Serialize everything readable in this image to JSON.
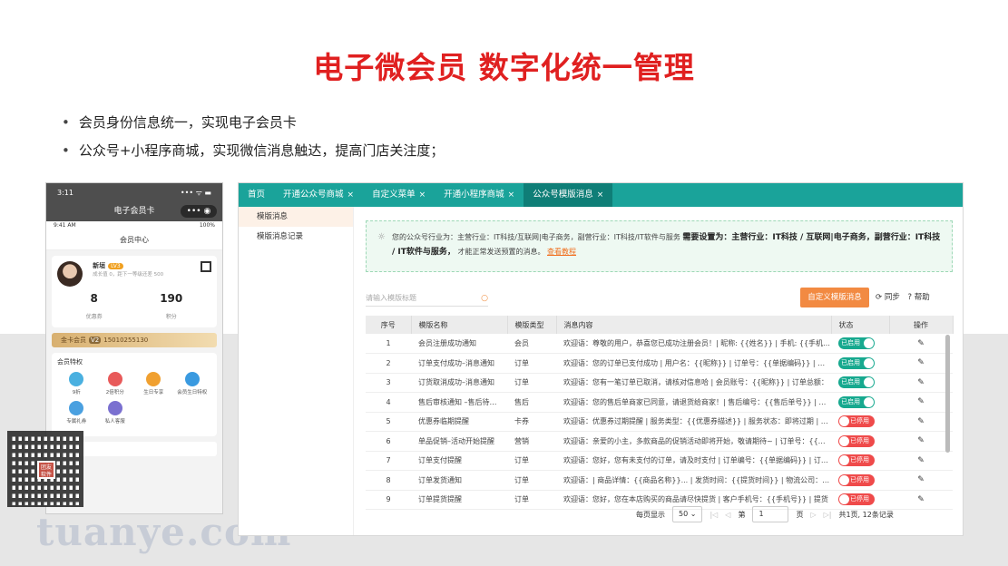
{
  "slide": {
    "title": "电子微会员  数字化统一管理",
    "bullets": [
      "会员身份信息统一，实现电子会员卡",
      "公众号+小程序商城，实现微信消息触达，提高门店关注度；"
    ],
    "watermark": "tuanye.com"
  },
  "phone": {
    "time": "3:11",
    "signal": "••• ᯤ ▬",
    "title": "电子会员卡",
    "pill": "•••  ◉",
    "inner_time": "9:41 AM",
    "battery": "100%",
    "header": "会员中心",
    "user": {
      "name": "新垣",
      "level": "LV3",
      "growth": "成长值 0，距下一等级还差 500"
    },
    "stats": [
      {
        "value": "8",
        "label": "优惠券"
      },
      {
        "value": "190",
        "label": "积分"
      }
    ],
    "gold": {
      "label": "金卡会员",
      "badge": "V2",
      "phone": "15010255130"
    },
    "privs_title": "会员特权",
    "privs": [
      {
        "label": "9折",
        "color": "#4ab0e0"
      },
      {
        "label": "2倍积分",
        "color": "#e85a5a"
      },
      {
        "label": "生日专享",
        "color": "#f0a030"
      },
      {
        "label": "会员生日特权",
        "color": "#3a9ae0"
      },
      {
        "label": "专属礼券",
        "color": "#4aa0e0"
      },
      {
        "label": "私人客服",
        "color": "#7a70d0"
      }
    ],
    "qr_logo": "团友软件"
  },
  "admin": {
    "tabs": [
      {
        "label": "首页",
        "close": false,
        "active": false
      },
      {
        "label": "开通公众号商城",
        "close": true,
        "active": false
      },
      {
        "label": "自定义菜单",
        "close": true,
        "active": false
      },
      {
        "label": "开通小程序商城",
        "close": true,
        "active": false
      },
      {
        "label": "公众号模版消息",
        "close": true,
        "active": true
      }
    ],
    "close_glyph": "×",
    "side": [
      "模版消息",
      "模版消息记录"
    ],
    "notice": {
      "normal": "您的公众号行业为：主营行业：IT科技/互联网|电子商务，副营行业：IT科技/IT软件与服务",
      "bold": "需要设置为：主营行业：IT科技 / 互联网|电子商务，副营行业：IT科技 / IT软件与服务，",
      "tail": "才能正常发送预置的消息。",
      "link": "查看教程"
    },
    "search_placeholder": "请输入模版标题",
    "custom_button": "自定义模版消息",
    "sync": "⟳ 同步",
    "help": "? 帮助",
    "columns": [
      "序号",
      "模版名称",
      "模版类型",
      "消息内容",
      "状态",
      "操作"
    ],
    "rows": [
      {
        "no": "1",
        "name": "会员注册成功通知",
        "type": "会员",
        "content": "欢迎语：尊敬的用户，恭喜您已成功注册会员！| 昵称: {{姓名}} | 手机: {{手机号}}",
        "status": "已启用",
        "on": true
      },
      {
        "no": "2",
        "name": "订单支付成功–消息通知",
        "type": "订单",
        "content": "欢迎语：您的订单已支付成功 | 用户名：{{昵称}} | 订单号：{{单据编码}} | 订单金额",
        "status": "已启用",
        "on": true
      },
      {
        "no": "3",
        "name": "订货取消成功–消息通知",
        "type": "订单",
        "content": "欢迎语：您有一笔订单已取消，请核对信息哈 | 会员账号：{{昵称}} | 订单总额：",
        "status": "已启用",
        "on": true
      },
      {
        "no": "4",
        "name": "售后审核通知 –售后待…",
        "type": "售后",
        "content": "欢迎语：您的售后单商家已同意，请退货给商家！| 售后编号：{{售后单号}} | 售后",
        "status": "已启用",
        "on": true
      },
      {
        "no": "5",
        "name": "优惠券临期提醒",
        "type": "卡券",
        "content": "欢迎语：优惠券过期提醒 | 服务类型：{{优惠券描述}} | 服务状态：即将过期 | 到期",
        "status": "已停用",
        "on": false
      },
      {
        "no": "6",
        "name": "单品促销–活动开始提醒",
        "type": "营销",
        "content": "欢迎语：亲爱的小主，多款商品的促销活动即将开始，敬请期待~ | 订单号：{{单号}}",
        "status": "已停用",
        "on": false
      },
      {
        "no": "7",
        "name": "订单支付提醒",
        "type": "订单",
        "content": "欢迎语：您好，您有未支付的订单，请及时支付 | 订单编号：{{单据编码}} | 订单金额",
        "status": "已停用",
        "on": false
      },
      {
        "no": "8",
        "name": "订单发货通知",
        "type": "订单",
        "content": "欢迎语：| 商品详情：{{商品名称}}... | 发货时间：{{提货时间}} | 物流公司：{{物流}}",
        "status": "已停用",
        "on": false
      },
      {
        "no": "9",
        "name": "订单提货提醒",
        "type": "订单",
        "content": "欢迎语：您好，您在本店购买的商品请尽快提货 | 客户手机号：{{手机号}} | 提货",
        "status": "已停用",
        "on": false
      }
    ],
    "edit_icon": "✎",
    "pager": {
      "per_page_label": "每页显示",
      "per_page": "50",
      "first": "|◁",
      "prev": "◁",
      "page_label": "第",
      "page": "1",
      "page_unit": "页",
      "next": "▷",
      "last": "▷|",
      "total": "共1页, 12条记录"
    }
  }
}
